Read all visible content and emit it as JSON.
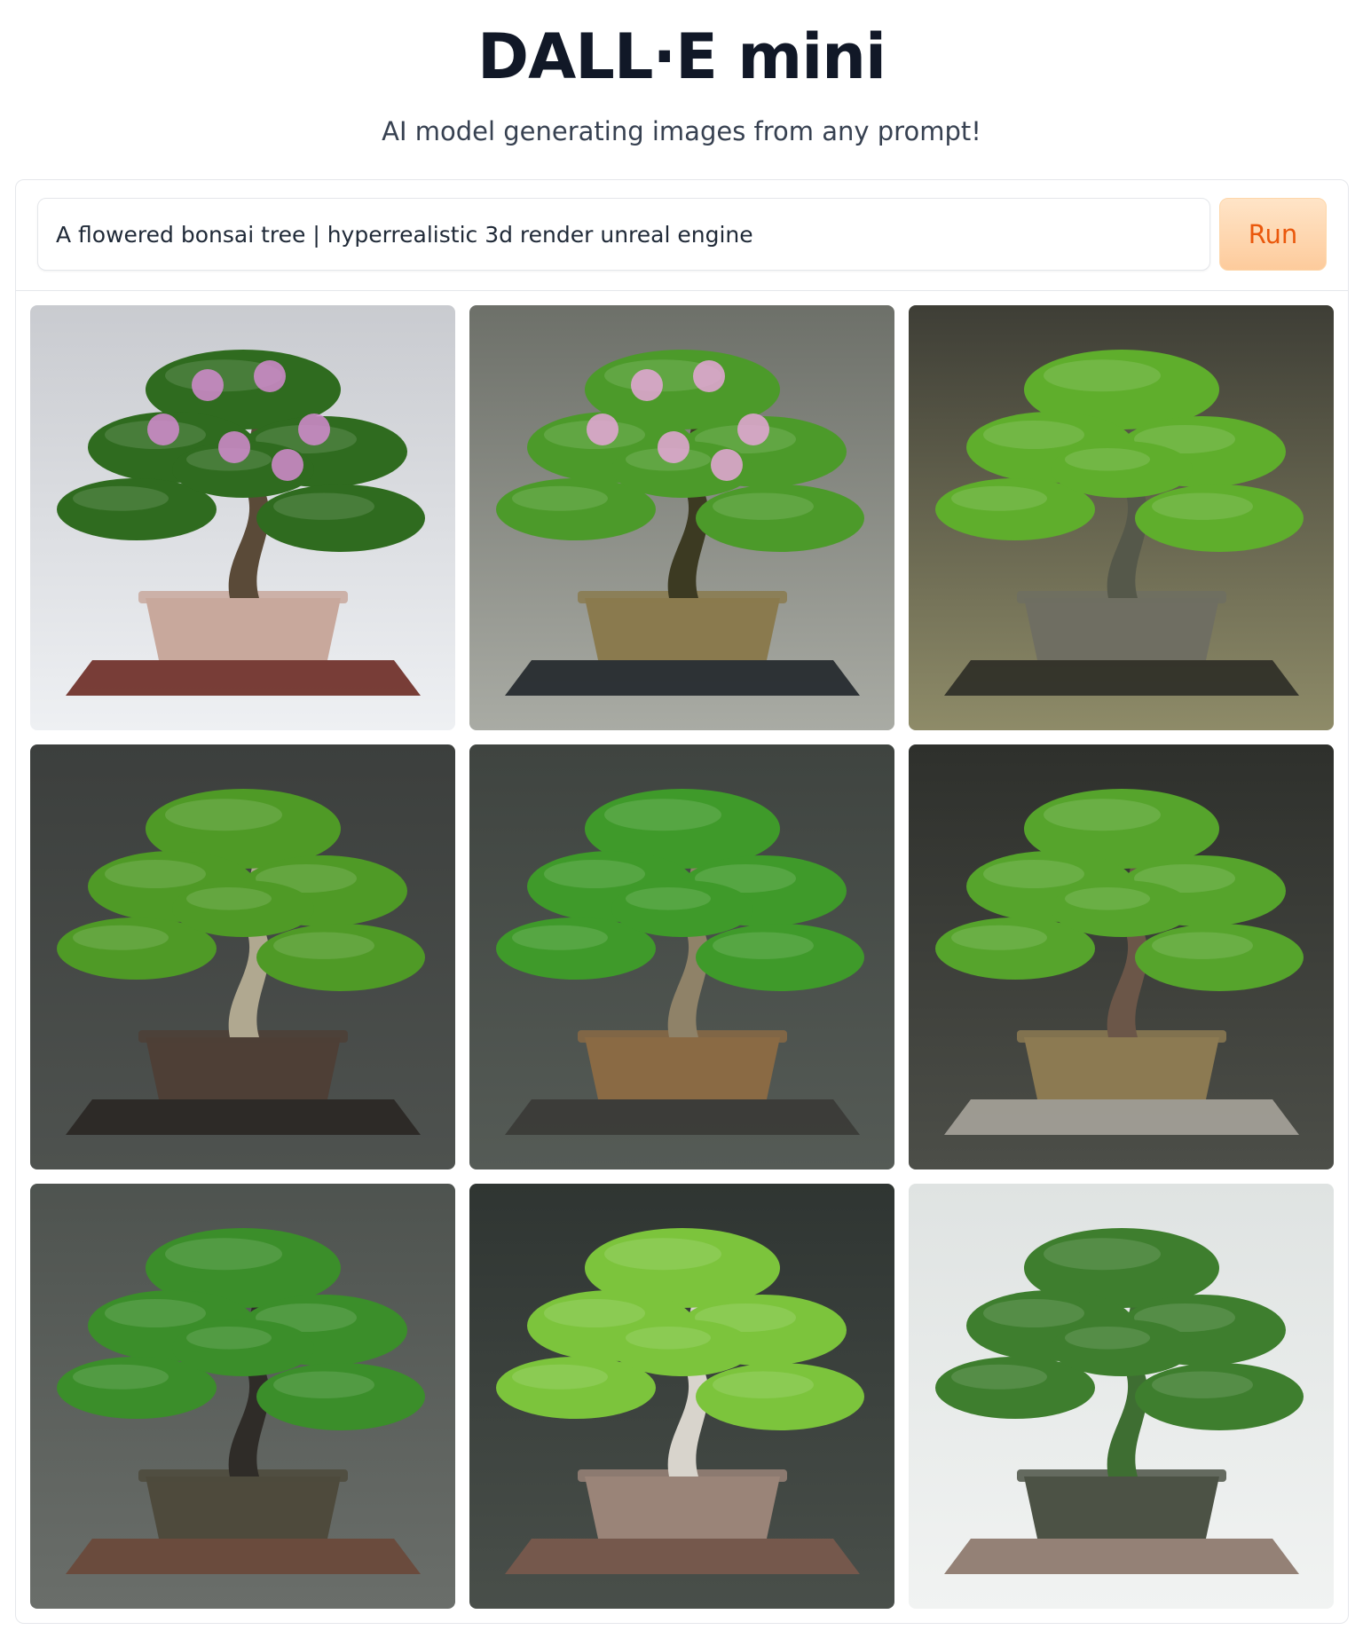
{
  "header": {
    "title": "DALL·E mini",
    "subtitle": "AI model generating images from any prompt!"
  },
  "prompt": {
    "value": "A flowered bonsai tree | hyperrealistic 3d render unreal engine"
  },
  "run_button": {
    "label": "Run",
    "color": "#ea580c",
    "background": "#fdd7b0"
  },
  "gallery": {
    "images": [
      {
        "name": "bonsai-image-1",
        "bg_top": "#c9cbd0",
        "bg_bottom": "#eef0f3",
        "foliage": "#2f6b1f",
        "flowers": "#d48ad0",
        "pot": "#c8a89c",
        "stand": "#6b2a22",
        "trunk": "#5a4a38"
      },
      {
        "name": "bonsai-image-2",
        "bg_top": "#6d7069",
        "bg_bottom": "#a9aba4",
        "foliage": "#4c9a2a",
        "flowers": "#e6a6d8",
        "pot": "#8a7a4e",
        "stand": "#20262a",
        "trunk": "#3c3a22"
      },
      {
        "name": "bonsai-image-3",
        "bg_top": "#3e3e36",
        "bg_bottom": "#8e8b68",
        "foliage": "#5fae2c",
        "flowers": "",
        "pot": "#6f6e62",
        "stand": "#2c2c26",
        "trunk": "#55584a"
      },
      {
        "name": "bonsai-image-4",
        "bg_top": "#3c3f3d",
        "bg_bottom": "#4e524f",
        "foliage": "#4f9a26",
        "flowers": "",
        "pot": "#4e3f36",
        "stand": "#2a2624",
        "trunk": "#b0a890"
      },
      {
        "name": "bonsai-image-5",
        "bg_top": "#3f4440",
        "bg_bottom": "#555b56",
        "foliage": "#3f9a2a",
        "flowers": "",
        "pot": "#8a6a44",
        "stand": "#3a3a36",
        "trunk": "#8f8268"
      },
      {
        "name": "bonsai-image-6",
        "bg_top": "#2e302c",
        "bg_bottom": "#4c4e48",
        "foliage": "#56a42c",
        "flowers": "",
        "pot": "#8c7a52",
        "stand": "#a6a39a",
        "trunk": "#6b5648"
      },
      {
        "name": "bonsai-image-7",
        "bg_top": "#4e534f",
        "bg_bottom": "#6a6e6a",
        "foliage": "#3b8e2a",
        "flowers": "",
        "pot": "#4e4a3c",
        "stand": "#6a4838",
        "trunk": "#2f2c28"
      },
      {
        "name": "bonsai-image-8",
        "bg_top": "#2f3532",
        "bg_bottom": "#494f4a",
        "foliage": "#7cc43c",
        "flowers": "",
        "pot": "#9a8478",
        "stand": "#7a5a4c",
        "trunk": "#d8d4cc"
      },
      {
        "name": "bonsai-image-9",
        "bg_top": "#dfe3e2",
        "bg_bottom": "#f1f3f2",
        "foliage": "#3e7e2e",
        "flowers": "",
        "pot": "#4c5245",
        "stand": "#8a7468",
        "trunk": "#3e6e32"
      }
    ]
  }
}
